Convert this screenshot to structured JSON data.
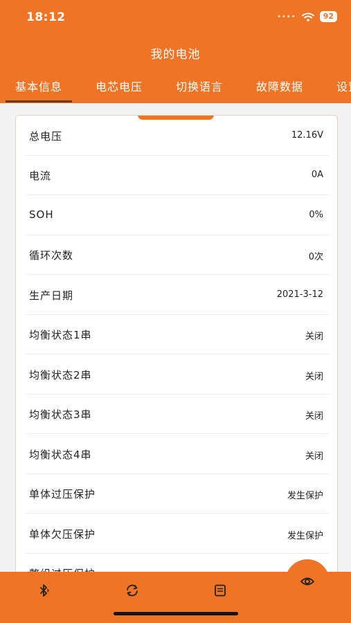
{
  "status_bar": {
    "time": "18:12",
    "battery": "92"
  },
  "header": {
    "title": "我的电池"
  },
  "tabs": [
    {
      "label": "基本信息"
    },
    {
      "label": "电芯电压"
    },
    {
      "label": "切换语言"
    },
    {
      "label": "故障数据"
    },
    {
      "label": "设置"
    }
  ],
  "rows": [
    {
      "label": "总电压",
      "value": "12.16V"
    },
    {
      "label": "电流",
      "value": "0A"
    },
    {
      "label": "SOH",
      "value": "0%"
    },
    {
      "label": "循环次数",
      "value": "0次"
    },
    {
      "label": "生产日期",
      "value": "2021-3-12"
    },
    {
      "label": "均衡状态1串",
      "value": "关闭"
    },
    {
      "label": "均衡状态2串",
      "value": "关闭"
    },
    {
      "label": "均衡状态3串",
      "value": "关闭"
    },
    {
      "label": "均衡状态4串",
      "value": "关闭"
    },
    {
      "label": "单体过压保护",
      "value": "发生保护"
    },
    {
      "label": "单体欠压保护",
      "value": "发生保护"
    },
    {
      "label": "整组过压保护",
      "value": ""
    }
  ],
  "bottom_nav": [
    {
      "icon": "bluetooth-icon"
    },
    {
      "icon": "refresh-icon"
    },
    {
      "icon": "document-icon"
    }
  ],
  "fab": {
    "icon": "eye-icon"
  },
  "colors": {
    "accent": "#f07426",
    "tab_indicator": "#6a3a1a"
  }
}
